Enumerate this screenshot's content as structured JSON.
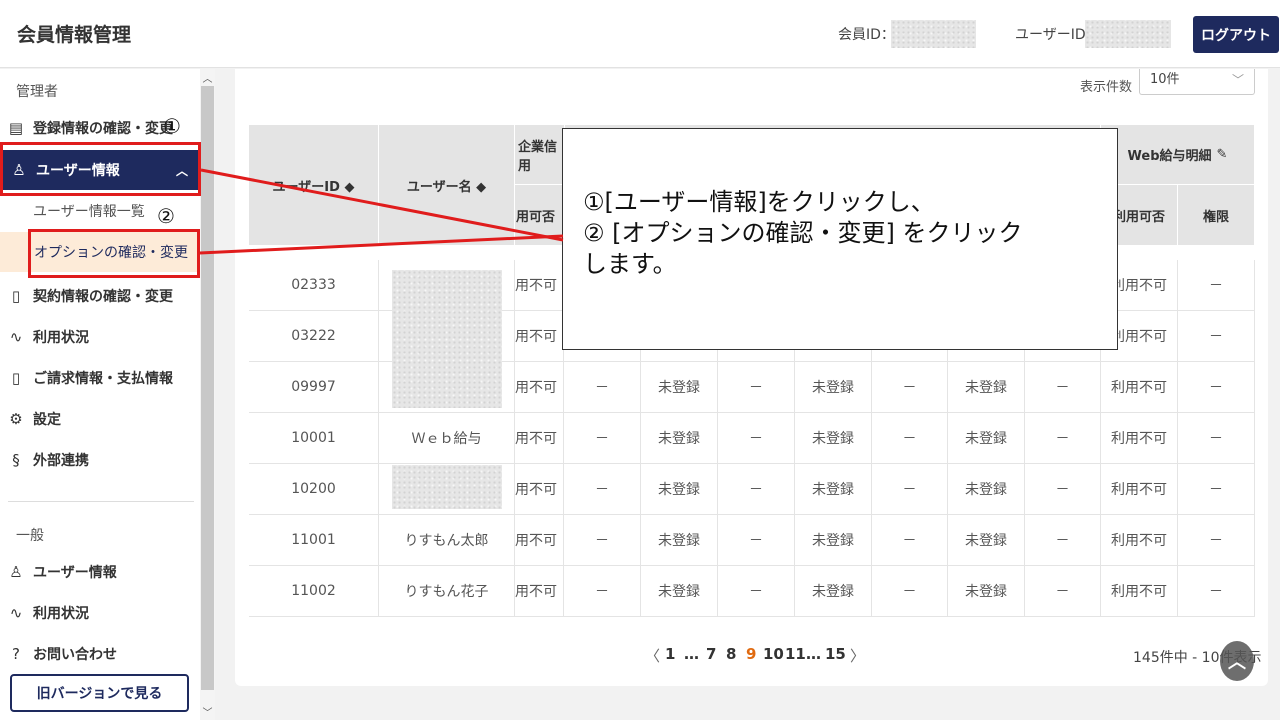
{
  "header": {
    "title": "会員情報管理",
    "member_id_label": "会員ID：",
    "user_id_label": "ユーザーID",
    "logout": "ログアウト"
  },
  "sidebar": {
    "admin_section": "管理者",
    "admin_items": [
      {
        "label": "登録情報の確認・変更",
        "icon": "building-icon"
      },
      {
        "label": "ユーザー情報",
        "icon": "user-icon"
      },
      {
        "label": "契約情報の確認・変更",
        "icon": "document-icon"
      },
      {
        "label": "利用状況",
        "icon": "activity-icon"
      },
      {
        "label": "ご請求情報・支払情報",
        "icon": "invoice-icon"
      },
      {
        "label": "設定",
        "icon": "gear-icon"
      },
      {
        "label": "外部連携",
        "icon": "link-icon"
      }
    ],
    "sub_items": [
      "ユーザー情報一覧",
      "オプションの確認・変更"
    ],
    "general_section": "一般",
    "general_items": [
      {
        "label": "ユーザー情報",
        "icon": "user-icon"
      },
      {
        "label": "利用状況",
        "icon": "activity-icon"
      },
      {
        "label": "お問い合わせ",
        "icon": "help-icon"
      }
    ],
    "old_version": "旧バージョンで見る"
  },
  "display_count": {
    "label": "表示件数",
    "value": "10件"
  },
  "table": {
    "headers": {
      "user_id": "ユーザーID ◆",
      "user_name": "ユーザー名 ◆",
      "group_company": "企業信用",
      "group_web": "Web給与明細",
      "usable": "用可否",
      "usable_full": "利用可否",
      "authority": "権限"
    },
    "rows": [
      {
        "id": "02333",
        "name": "",
        "c1": "用不可",
        "c2": "",
        "c3": "",
        "c4": "",
        "c5": "",
        "c6": "",
        "c7": "",
        "c8": "",
        "web": "利用不可",
        "auth": "－"
      },
      {
        "id": "03222",
        "name": "",
        "c1": "用不可",
        "c2": "",
        "c3": "",
        "c4": "",
        "c5": "",
        "c6": "",
        "c7": "",
        "c8": "",
        "web": "利用不可",
        "auth": "－"
      },
      {
        "id": "09997",
        "name": "",
        "c1": "用不可",
        "c2": "－",
        "c3": "未登録",
        "c4": "－",
        "c5": "未登録",
        "c6": "－",
        "c7": "未登録",
        "c8": "－",
        "web": "利用不可",
        "auth": "－"
      },
      {
        "id": "10001",
        "name": "Ｗｅｂ給与",
        "c1": "用不可",
        "c2": "－",
        "c3": "未登録",
        "c4": "－",
        "c5": "未登録",
        "c6": "－",
        "c7": "未登録",
        "c8": "－",
        "web": "利用不可",
        "auth": "－"
      },
      {
        "id": "10200",
        "name": "",
        "c1": "用不可",
        "c2": "－",
        "c3": "未登録",
        "c4": "－",
        "c5": "未登録",
        "c6": "－",
        "c7": "未登録",
        "c8": "－",
        "web": "利用不可",
        "auth": "－"
      },
      {
        "id": "11001",
        "name": "りすもん太郎",
        "c1": "用不可",
        "c2": "－",
        "c3": "未登録",
        "c4": "－",
        "c5": "未登録",
        "c6": "－",
        "c7": "未登録",
        "c8": "－",
        "web": "利用不可",
        "auth": "－"
      },
      {
        "id": "11002",
        "name": "りすもん花子",
        "c1": "用不可",
        "c2": "－",
        "c3": "未登録",
        "c4": "－",
        "c5": "未登録",
        "c6": "－",
        "c7": "未登録",
        "c8": "－",
        "web": "利用不可",
        "auth": "－"
      }
    ]
  },
  "pagination": {
    "prev": "〈",
    "next": "〉",
    "pages": [
      "1",
      "…",
      "7",
      "8",
      "9",
      "10",
      "11",
      "…",
      "15"
    ],
    "current": "9",
    "total": "145件中 - 10件表示"
  },
  "annotation": {
    "line1": "①[ユーザー情報]をクリックし、",
    "line2": "② [オプションの確認・変更] をクリック",
    "line3": "します。",
    "badge1": "①",
    "badge2": "②"
  },
  "colors": {
    "navy": "#1e2a5e",
    "accent_orange": "#e06a10",
    "annotation_red": "#e01c1c"
  }
}
